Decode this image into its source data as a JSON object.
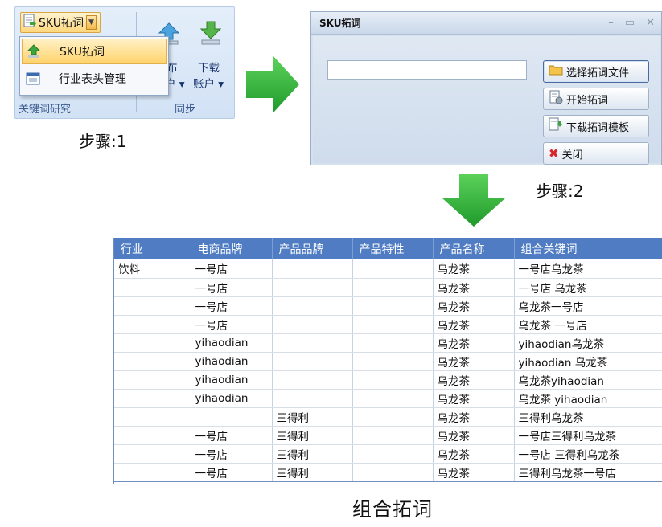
{
  "step1": {
    "ribbon": {
      "sku_button_label": "SKU拓词",
      "download_label_1": "下载",
      "download_label_2": "账户 ▾",
      "publish_partial_1": "布",
      "publish_partial_2": "户 ▾",
      "group_left": "关键词研究",
      "group_right": "同步"
    },
    "dropdown": {
      "items": [
        {
          "label": "SKU拓词",
          "icon": "green-up-arrow-icon"
        },
        {
          "label": "行业表头管理",
          "icon": "table-window-icon"
        }
      ]
    },
    "caption": "步骤:1"
  },
  "step2": {
    "dialog": {
      "title": "SKU拓词",
      "input_value": "",
      "buttons": [
        {
          "label": "选择拓词文件",
          "icon": "folder-icon"
        },
        {
          "label": "开始拓词",
          "icon": "document-gear-icon"
        },
        {
          "label": "下载拓词模板",
          "icon": "document-download-icon"
        },
        {
          "label": "关闭",
          "icon": "red-x-icon"
        }
      ]
    },
    "caption": "步骤:2"
  },
  "table": {
    "headers": [
      "行业",
      "电商品牌",
      "产品品牌",
      "产品特性",
      "产品名称",
      "组合关键词"
    ],
    "rows": [
      [
        "饮料",
        "一号店",
        "",
        "",
        "乌龙茶",
        "一号店乌龙茶"
      ],
      [
        "",
        "一号店",
        "",
        "",
        "乌龙茶",
        "一号店 乌龙茶"
      ],
      [
        "",
        "一号店",
        "",
        "",
        "乌龙茶",
        "乌龙茶一号店"
      ],
      [
        "",
        "一号店",
        "",
        "",
        "乌龙茶",
        "乌龙茶 一号店"
      ],
      [
        "",
        "yihaodian",
        "",
        "",
        "乌龙茶",
        "yihaodian乌龙茶"
      ],
      [
        "",
        "yihaodian",
        "",
        "",
        "乌龙茶",
        "yihaodian 乌龙茶"
      ],
      [
        "",
        "yihaodian",
        "",
        "",
        "乌龙茶",
        "乌龙茶yihaodian"
      ],
      [
        "",
        "yihaodian",
        "",
        "",
        "乌龙茶",
        "乌龙茶 yihaodian"
      ],
      [
        "",
        "",
        "三得利",
        "",
        "乌龙茶",
        "三得利乌龙茶"
      ],
      [
        "",
        "一号店",
        "三得利",
        "",
        "乌龙茶",
        "一号店三得利乌龙茶"
      ],
      [
        "",
        "一号店",
        "三得利",
        "",
        "乌龙茶",
        "一号店 三得利乌龙茶"
      ],
      [
        "",
        "一号店",
        "三得利",
        "",
        "乌龙茶",
        "三得利乌龙茶一号店"
      ]
    ],
    "caption": "组合拓词"
  },
  "colors": {
    "arrow_green": "#2fae3b",
    "table_header": "#4f7cc2",
    "ribbon_bg": "#d9e6f6"
  }
}
